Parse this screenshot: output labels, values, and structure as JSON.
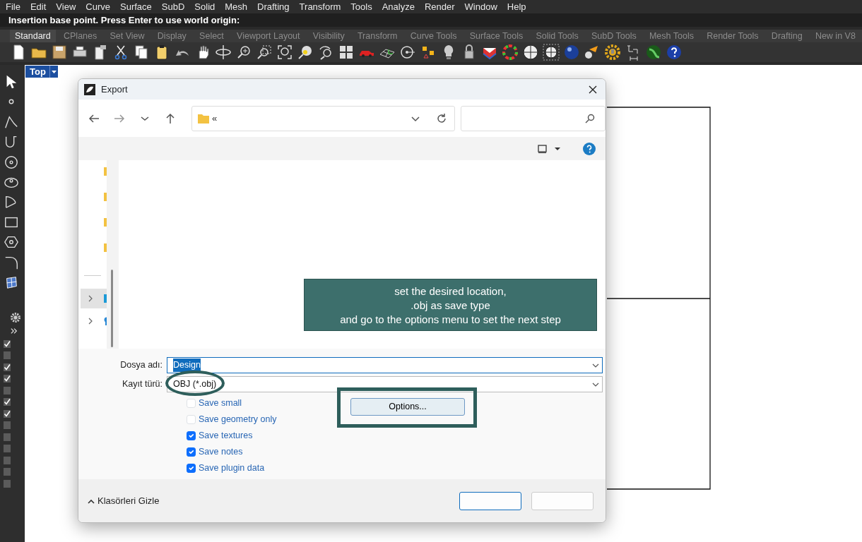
{
  "menu": [
    "File",
    "Edit",
    "View",
    "Curve",
    "Surface",
    "SubD",
    "Solid",
    "Mesh",
    "Drafting",
    "Transform",
    "Tools",
    "Analyze",
    "Render",
    "Window",
    "Help"
  ],
  "command_prompt": "Insertion base point. Press Enter to use world origin:",
  "toolbar_tabs": [
    {
      "label": "Standard",
      "selected": true
    },
    {
      "label": "CPlanes",
      "selected": false
    },
    {
      "label": "Set View",
      "selected": false
    },
    {
      "label": "Display",
      "selected": false
    },
    {
      "label": "Select",
      "selected": false
    },
    {
      "label": "Viewport Layout",
      "selected": false
    },
    {
      "label": "Visibility",
      "selected": false
    },
    {
      "label": "Transform",
      "selected": false
    },
    {
      "label": "Curve Tools",
      "selected": false
    },
    {
      "label": "Surface Tools",
      "selected": false
    },
    {
      "label": "Solid Tools",
      "selected": false
    },
    {
      "label": "SubD Tools",
      "selected": false
    },
    {
      "label": "Mesh Tools",
      "selected": false
    },
    {
      "label": "Render Tools",
      "selected": false
    },
    {
      "label": "Drafting",
      "selected": false
    },
    {
      "label": "New in V8",
      "selected": false
    }
  ],
  "viewport": {
    "label": "Top"
  },
  "layer_checkboxes": [
    {
      "checked": true
    },
    {
      "checked": false
    },
    {
      "checked": true
    },
    {
      "checked": true
    },
    {
      "checked": false
    },
    {
      "checked": true
    },
    {
      "checked": true
    },
    {
      "checked": false
    },
    {
      "checked": false
    },
    {
      "checked": false
    },
    {
      "checked": false
    },
    {
      "checked": false
    },
    {
      "checked": false
    }
  ],
  "dialog": {
    "title": "Export",
    "address": "«",
    "file_name_label": "Dosya adı:",
    "file_name": "Design",
    "file_name_selected": true,
    "file_type_label": "Kayıt türü:",
    "file_type": "OBJ (*.obj)",
    "options": [
      {
        "label": "Save small",
        "checked": false
      },
      {
        "label": "Save geometry only",
        "checked": false
      },
      {
        "label": "Save textures",
        "checked": true
      },
      {
        "label": "Save notes",
        "checked": true
      },
      {
        "label": "Save plugin data",
        "checked": true
      }
    ],
    "options_button": "Options...",
    "hide_folders": "Klasörleri Gizle"
  },
  "annotation": {
    "lines": [
      "set the desired location,",
      ".obj as save type",
      "and go to the options menu to set the next step"
    ]
  }
}
